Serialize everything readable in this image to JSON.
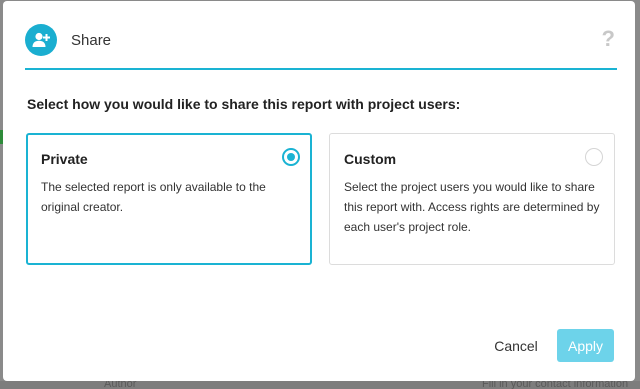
{
  "dialog": {
    "title": "Share",
    "header_icon": "add-user-icon",
    "help_icon": "?",
    "prompt": "Select how you would like to share this report with project users:"
  },
  "options": [
    {
      "title": "Private",
      "description": "The selected report is only available to the original creator.",
      "selected": true
    },
    {
      "title": "Custom",
      "description": "Select the project users you would like to share this report with. Access rights are determined by each user's project role.",
      "selected": false
    }
  ],
  "footer": {
    "cancel_label": "Cancel",
    "apply_label": "Apply"
  },
  "background": {
    "left_text": "Author",
    "right_text": "Fill in your contact information"
  },
  "colors": {
    "accent": "#1ab3d3",
    "apply_disabled": "#6dd3ea",
    "overlay": "#8a8a8a"
  }
}
